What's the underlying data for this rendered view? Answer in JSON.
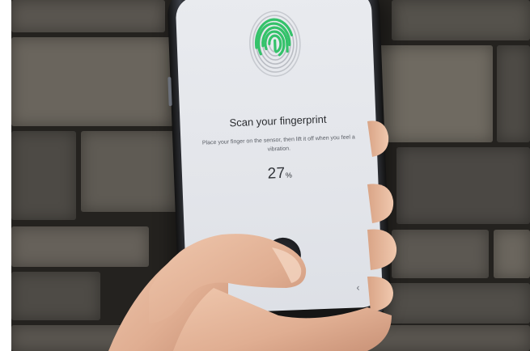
{
  "screen": {
    "title": "Scan your fingerprint",
    "instruction": "Place your finger on the sensor, then lift it off when you feel a vibration.",
    "progress_value": "27",
    "progress_unit": "%",
    "progress_fraction": 0.27,
    "back_icon": "‹"
  },
  "colors": {
    "fingerprint_scanned": "#34c26a",
    "fingerprint_unscanned": "#b9bcc3",
    "screen_bg": "#e6e8ec",
    "wall": "#4a4843"
  },
  "icons": [
    "fingerprint-icon",
    "back-nav-icon"
  ]
}
